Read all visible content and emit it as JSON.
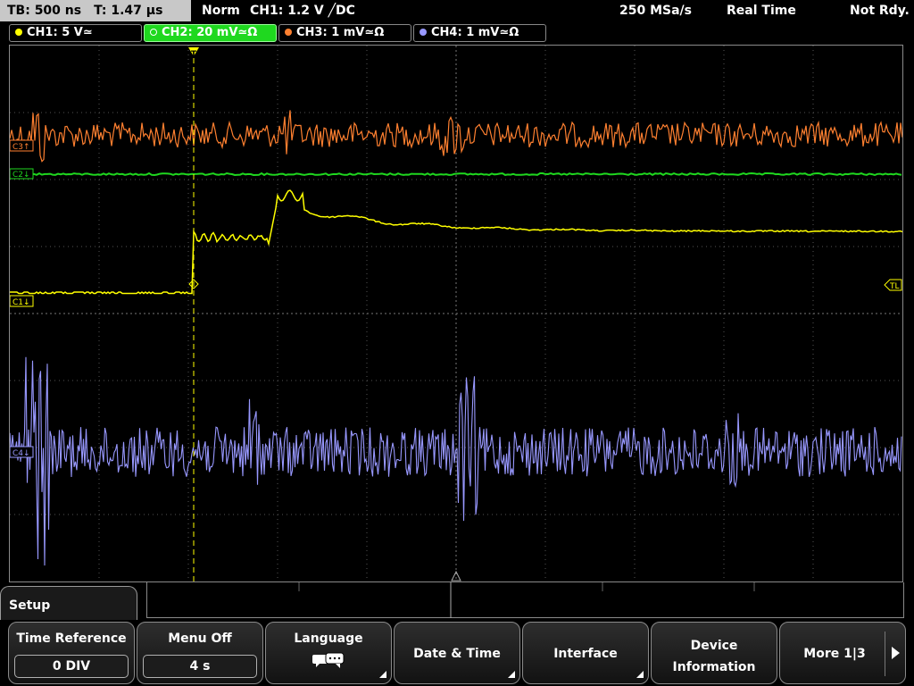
{
  "status": {
    "timebase": "TB: 500 ns",
    "trigger_time": "T: 1.47 µs",
    "mode": "Norm",
    "trigger": "CH1: 1.2 V ╱DC",
    "sample_rate": "250 MSa/s",
    "acquisition": "Real Time",
    "state": "Not Rdy."
  },
  "channels": [
    {
      "label": "CH1: 5 V≃",
      "color": "#ffff00"
    },
    {
      "label": "CH2: 20 mV≃Ω",
      "color": "#1fd81f",
      "active": true
    },
    {
      "label": "CH3: 1 mV≃Ω",
      "color": "#ff8030"
    },
    {
      "label": "CH4: 1 mV≃Ω",
      "color": "#9898ff"
    }
  ],
  "markers": {
    "ch3": "C3↑",
    "ch2": "C2↓",
    "ch1": "C1↓",
    "ch4": "C4↓",
    "trigger_level": "TL",
    "trigger_pos": "T"
  },
  "menu": {
    "title": "Setup",
    "softkeys": [
      {
        "label": "Time Reference",
        "value": "0 DIV"
      },
      {
        "label": "Menu Off",
        "value": "4 s"
      },
      {
        "label": "Language"
      },
      {
        "label": "Date & Time"
      },
      {
        "label": "Interface"
      },
      {
        "label_line1": "Device",
        "label_line2": "Information"
      },
      {
        "label": "More 1|3"
      }
    ]
  },
  "colors": {
    "ch1": "#ffff00",
    "ch2": "#1fd81f",
    "ch3": "#ff8030",
    "ch4": "#9898ff",
    "grid": "#555555"
  },
  "icons": {
    "language": "speech-bubbles-icon",
    "more": "arrow-right-icon"
  }
}
